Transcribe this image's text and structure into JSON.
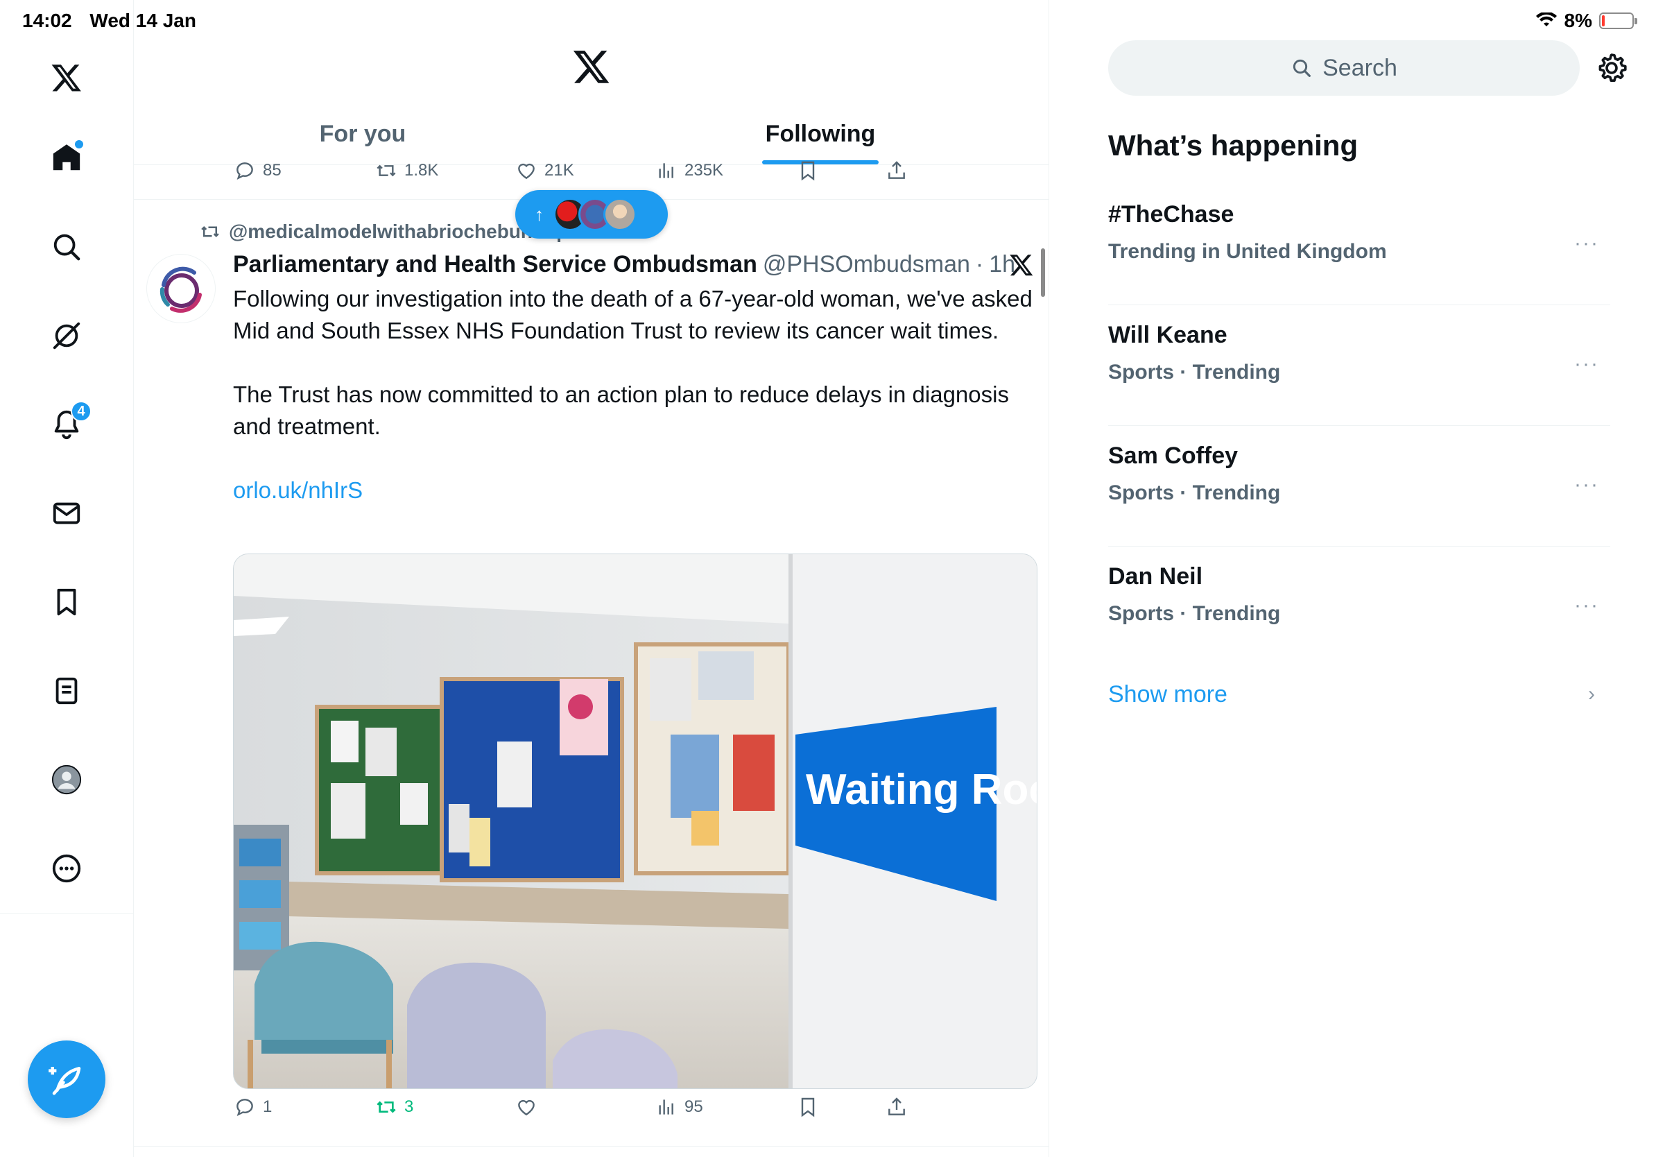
{
  "status_bar": {
    "time": "14:02",
    "date": "Wed 14 Jan",
    "battery": "8%",
    "battery_level": 0.08,
    "colors": {
      "battery_low": "#ff3b30"
    }
  },
  "nav": {
    "items": [
      "x-logo",
      "home",
      "search",
      "grok",
      "notifications",
      "messages",
      "bookmarks",
      "lists",
      "profile",
      "more"
    ],
    "notifications_badge": "4",
    "accent": "#1d9bf0"
  },
  "tabs": [
    {
      "label": "For you",
      "active": false
    },
    {
      "label": "Following",
      "active": true
    }
  ],
  "prev_post_actions": {
    "replies": "85",
    "reposts": "1.8K",
    "likes": "21K",
    "views": "235K"
  },
  "post": {
    "reposted_by": "@medicalmodelwithabriochebun reposted",
    "author_name": "Parliamentary and Health Service Ombudsman",
    "author_handle": "@PHSOmbudsman",
    "separator": "·",
    "time": "1h",
    "paragraph1": "Following our investigation into the death of a 67-year-old woman, we've asked Mid and South Essex NHS Foundation Trust to review its cancer wait times.",
    "paragraph2": "The Trust has now committed to an action plan to reduce delays in diagnosis and treatment.",
    "link": "orlo.uk/nhIrS",
    "image_sign_text": "Waiting Room",
    "actions": {
      "replies": "1",
      "reposts": "3",
      "likes": "",
      "views": "95"
    },
    "repost_color": "#00ba7c"
  },
  "right": {
    "search_placeholder": "Search",
    "section_title": "What’s happening",
    "trends": [
      {
        "name": "#TheChase",
        "meta": "Trending in United Kingdom"
      },
      {
        "name": "Will Keane",
        "meta": "Sports · Trending"
      },
      {
        "name": "Sam Coffey",
        "meta": "Sports · Trending"
      },
      {
        "name": "Dan Neil",
        "meta": "Sports · Trending"
      }
    ],
    "more_glyph": "···",
    "show_more": "Show more"
  }
}
